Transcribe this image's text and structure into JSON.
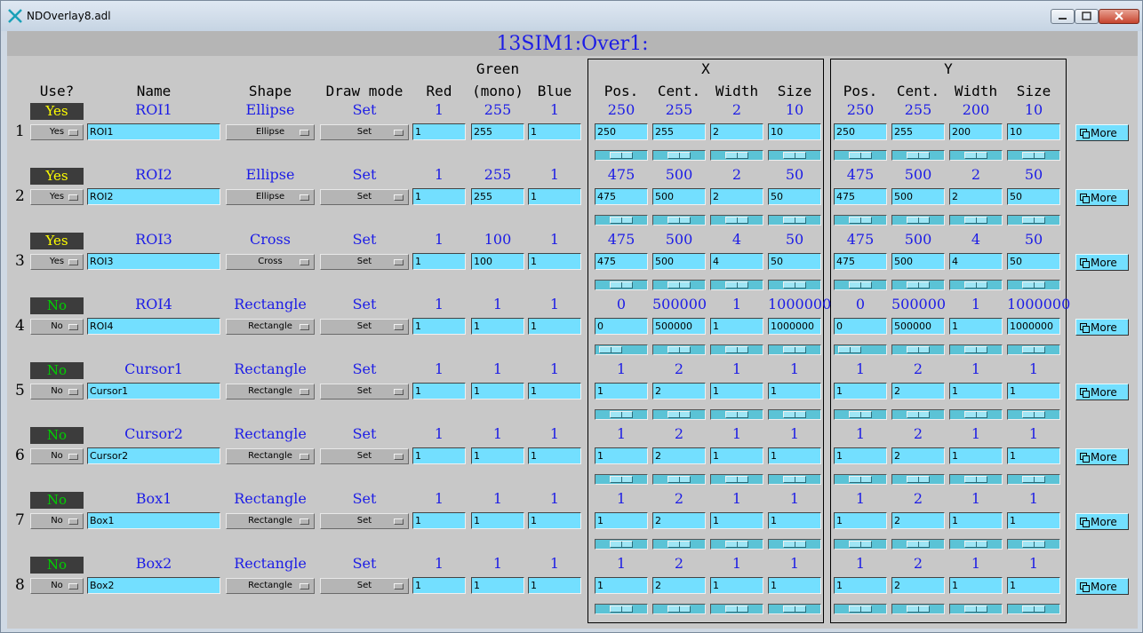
{
  "window": {
    "title": "NDOverlay8.adl"
  },
  "pv_prefix": "13SIM1:Over1:",
  "headers": {
    "use": "Use?",
    "name": "Name",
    "shape": "Shape",
    "draw_mode": "Draw mode",
    "red": "Red",
    "green_top": "Green",
    "green_bottom": "(mono)",
    "blue": "Blue",
    "x_group": "X",
    "y_group": "Y",
    "pos": "Pos.",
    "cent": "Cent.",
    "width": "Width",
    "size": "Size"
  },
  "more_label": "More",
  "colors": {
    "yes": "#ffff00",
    "no": "#00d200",
    "readback": "#1c1ce6",
    "field_bg": "#73dfff",
    "panel_bg": "#c8c8c8"
  },
  "overlays": [
    {
      "num": "1",
      "use_rb": "Yes",
      "use_menu": "Yes",
      "name_rb": "ROI1",
      "name": "ROI1",
      "shape_rb": "Ellipse",
      "shape_menu": "Ellipse",
      "draw_rb": "Set",
      "draw_menu": "Set",
      "red_rb": "1",
      "red": "1",
      "green_rb": "255",
      "green": "255",
      "blue_rb": "1",
      "blue": "1",
      "x_pos_rb": "250",
      "x_pos": "250",
      "x_cent_rb": "255",
      "x_cent": "255",
      "x_width_rb": "2",
      "x_width": "2",
      "x_size_rb": "10",
      "x_size": "10",
      "y_pos_rb": "250",
      "y_pos": "250",
      "y_cent_rb": "255",
      "y_cent": "255",
      "y_width_rb": "200",
      "y_width": "200",
      "y_size_rb": "10",
      "y_size": "10",
      "slider_x": [
        0.5,
        0.5,
        0.5,
        0.5
      ],
      "slider_y": [
        0.5,
        0.5,
        0.5,
        0.5
      ]
    },
    {
      "num": "2",
      "use_rb": "Yes",
      "use_menu": "Yes",
      "name_rb": "ROI2",
      "name": "ROI2",
      "shape_rb": "Ellipse",
      "shape_menu": "Ellipse",
      "draw_rb": "Set",
      "draw_menu": "Set",
      "red_rb": "1",
      "red": "1",
      "green_rb": "255",
      "green": "255",
      "blue_rb": "1",
      "blue": "1",
      "x_pos_rb": "475",
      "x_pos": "475",
      "x_cent_rb": "500",
      "x_cent": "500",
      "x_width_rb": "2",
      "x_width": "2",
      "x_size_rb": "50",
      "x_size": "50",
      "y_pos_rb": "475",
      "y_pos": "475",
      "y_cent_rb": "500",
      "y_cent": "500",
      "y_width_rb": "2",
      "y_width": "2",
      "y_size_rb": "50",
      "y_size": "50",
      "slider_x": [
        0.5,
        0.5,
        0.5,
        0.5
      ],
      "slider_y": [
        0.5,
        0.5,
        0.5,
        0.5
      ]
    },
    {
      "num": "3",
      "use_rb": "Yes",
      "use_menu": "Yes",
      "name_rb": "ROI3",
      "name": "ROI3",
      "shape_rb": "Cross",
      "shape_menu": "Cross",
      "draw_rb": "Set",
      "draw_menu": "Set",
      "red_rb": "1",
      "red": "1",
      "green_rb": "100",
      "green": "100",
      "blue_rb": "1",
      "blue": "1",
      "x_pos_rb": "475",
      "x_pos": "475",
      "x_cent_rb": "500",
      "x_cent": "500",
      "x_width_rb": "4",
      "x_width": "4",
      "x_size_rb": "50",
      "x_size": "50",
      "y_pos_rb": "475",
      "y_pos": "475",
      "y_cent_rb": "500",
      "y_cent": "500",
      "y_width_rb": "4",
      "y_width": "4",
      "y_size_rb": "50",
      "y_size": "50",
      "slider_x": [
        0.5,
        0.5,
        0.5,
        0.5
      ],
      "slider_y": [
        0.5,
        0.5,
        0.5,
        0.5
      ]
    },
    {
      "num": "4",
      "use_rb": "No",
      "use_menu": "No",
      "name_rb": "ROI4",
      "name": "ROI4",
      "shape_rb": "Rectangle",
      "shape_menu": "Rectangle",
      "draw_rb": "Set",
      "draw_menu": "Set",
      "red_rb": "1",
      "red": "1",
      "green_rb": "1",
      "green": "1",
      "blue_rb": "1",
      "blue": "1",
      "x_pos_rb": "0",
      "x_pos": "0",
      "x_cent_rb": "500000",
      "x_cent": "500000",
      "x_width_rb": "1",
      "x_width": "1",
      "x_size_rb": "1000000",
      "x_size": "1000000",
      "y_pos_rb": "0",
      "y_pos": "0",
      "y_cent_rb": "500000",
      "y_cent": "500000",
      "y_width_rb": "1",
      "y_width": "1",
      "y_size_rb": "1000000",
      "y_size": "1000000",
      "slider_x": [
        0.1,
        0.5,
        0.5,
        0.5
      ],
      "slider_y": [
        0.1,
        0.5,
        0.5,
        0.5
      ]
    },
    {
      "num": "5",
      "use_rb": "No",
      "use_menu": "No",
      "name_rb": "Cursor1",
      "name": "Cursor1",
      "shape_rb": "Rectangle",
      "shape_menu": "Rectangle",
      "draw_rb": "Set",
      "draw_menu": "Set",
      "red_rb": "1",
      "red": "1",
      "green_rb": "1",
      "green": "1",
      "blue_rb": "1",
      "blue": "1",
      "x_pos_rb": "1",
      "x_pos": "1",
      "x_cent_rb": "2",
      "x_cent": "2",
      "x_width_rb": "1",
      "x_width": "1",
      "x_size_rb": "1",
      "x_size": "1",
      "y_pos_rb": "1",
      "y_pos": "1",
      "y_cent_rb": "2",
      "y_cent": "2",
      "y_width_rb": "1",
      "y_width": "1",
      "y_size_rb": "1",
      "y_size": "1",
      "slider_x": [
        0.5,
        0.5,
        0.5,
        0.5
      ],
      "slider_y": [
        0.5,
        0.5,
        0.5,
        0.5
      ]
    },
    {
      "num": "6",
      "use_rb": "No",
      "use_menu": "No",
      "name_rb": "Cursor2",
      "name": "Cursor2",
      "shape_rb": "Rectangle",
      "shape_menu": "Rectangle",
      "draw_rb": "Set",
      "draw_menu": "Set",
      "red_rb": "1",
      "red": "1",
      "green_rb": "1",
      "green": "1",
      "blue_rb": "1",
      "blue": "1",
      "x_pos_rb": "1",
      "x_pos": "1",
      "x_cent_rb": "2",
      "x_cent": "2",
      "x_width_rb": "1",
      "x_width": "1",
      "x_size_rb": "1",
      "x_size": "1",
      "y_pos_rb": "1",
      "y_pos": "1",
      "y_cent_rb": "2",
      "y_cent": "2",
      "y_width_rb": "1",
      "y_width": "1",
      "y_size_rb": "1",
      "y_size": "1",
      "slider_x": [
        0.5,
        0.5,
        0.5,
        0.5
      ],
      "slider_y": [
        0.5,
        0.5,
        0.5,
        0.5
      ]
    },
    {
      "num": "7",
      "use_rb": "No",
      "use_menu": "No",
      "name_rb": "Box1",
      "name": "Box1",
      "shape_rb": "Rectangle",
      "shape_menu": "Rectangle",
      "draw_rb": "Set",
      "draw_menu": "Set",
      "red_rb": "1",
      "red": "1",
      "green_rb": "1",
      "green": "1",
      "blue_rb": "1",
      "blue": "1",
      "x_pos_rb": "1",
      "x_pos": "1",
      "x_cent_rb": "2",
      "x_cent": "2",
      "x_width_rb": "1",
      "x_width": "1",
      "x_size_rb": "1",
      "x_size": "1",
      "y_pos_rb": "1",
      "y_pos": "1",
      "y_cent_rb": "2",
      "y_cent": "2",
      "y_width_rb": "1",
      "y_width": "1",
      "y_size_rb": "1",
      "y_size": "1",
      "slider_x": [
        0.5,
        0.5,
        0.5,
        0.5
      ],
      "slider_y": [
        0.5,
        0.5,
        0.5,
        0.5
      ]
    },
    {
      "num": "8",
      "use_rb": "No",
      "use_menu": "No",
      "name_rb": "Box2",
      "name": "Box2",
      "shape_rb": "Rectangle",
      "shape_menu": "Rectangle",
      "draw_rb": "Set",
      "draw_menu": "Set",
      "red_rb": "1",
      "red": "1",
      "green_rb": "1",
      "green": "1",
      "blue_rb": "1",
      "blue": "1",
      "x_pos_rb": "1",
      "x_pos": "1",
      "x_cent_rb": "2",
      "x_cent": "2",
      "x_width_rb": "1",
      "x_width": "1",
      "x_size_rb": "1",
      "x_size": "1",
      "y_pos_rb": "1",
      "y_pos": "1",
      "y_cent_rb": "2",
      "y_cent": "2",
      "y_width_rb": "1",
      "y_width": "1",
      "y_size_rb": "1",
      "y_size": "1",
      "slider_x": [
        0.5,
        0.5,
        0.5,
        0.5
      ],
      "slider_y": [
        0.5,
        0.5,
        0.5,
        0.5
      ]
    }
  ]
}
